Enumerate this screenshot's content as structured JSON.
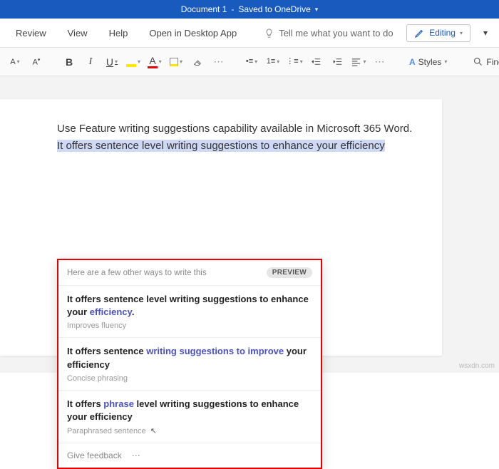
{
  "titlebar": {
    "doc": "Document 1",
    "status": "Saved to OneDrive"
  },
  "menu": {
    "review": "Review",
    "view": "View",
    "help": "Help",
    "open_desktop": "Open in Desktop App",
    "tell_me": "Tell me what you want to do",
    "editing": "Editing"
  },
  "toolbar": {
    "bold": "B",
    "italic": "I",
    "underline": "U",
    "font_a": "A",
    "fill": "",
    "eraser": "",
    "bullets": "",
    "numbers": "",
    "outdent": "",
    "indent": "",
    "align": "",
    "more": "⋯",
    "styles_a": "A",
    "styles_label": "Styles",
    "find_label": "Find"
  },
  "document": {
    "line1": "Use Feature writing suggestions capability available in Microsoft 365 Word. ",
    "line2_hl": "It offers sentence level writing suggestions to enhance your efficiency"
  },
  "suggestions": {
    "header": "Here are a few other ways to write this",
    "badge": "PREVIEW",
    "items": [
      {
        "pre": "It offers sentence level writing suggestions to enhance your ",
        "kw": "efficiency",
        "post": ".",
        "hint": "Improves fluency"
      },
      {
        "pre": "It offers sentence ",
        "kw": "writing suggestions to improve",
        "post": " your efficiency",
        "hint": "Concise phrasing"
      },
      {
        "pre": "It offers ",
        "kw": "phrase",
        "post": " level writing suggestions to enhance your efficiency",
        "hint": "Paraphrased sentence"
      }
    ],
    "feedback": "Give feedback",
    "more": "⋯"
  },
  "watermark": "wsxdn.com"
}
